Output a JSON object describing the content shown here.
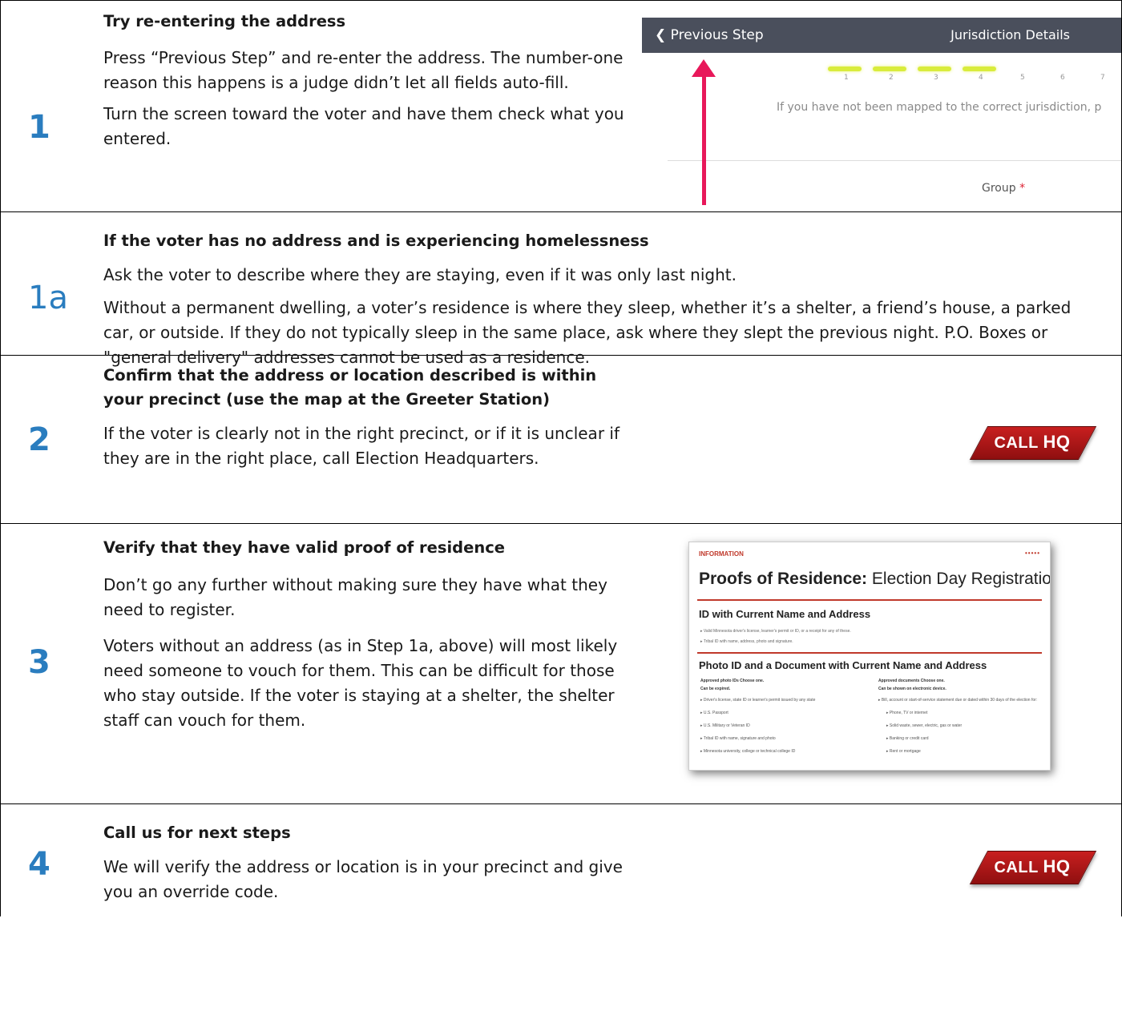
{
  "rows": [
    {
      "number": "1",
      "heading": "Try re-entering the address",
      "paragraphs": [
        "Press “Previous Step” and re-enter the address. The number-one reason this happens is a judge didn’t let all fields auto-fill.",
        "Turn the screen toward the voter and have them check what you entered."
      ],
      "screenshot": {
        "back_label": "Previous Step",
        "title": "Jurisdiction Details",
        "step_numbers": [
          "1",
          "2",
          "3",
          "4",
          "5",
          "6",
          "7"
        ],
        "note": "If you have not been mapped to the correct jurisdiction, p",
        "field_label": "Group",
        "required_mark": "*"
      }
    },
    {
      "number": "1a",
      "heading": "If the voter has no address and is experiencing homelessness",
      "paragraphs": [
        "Ask the voter to describe where they are staying, even if it was only last night.",
        "Without a permanent dwelling, a voter’s residence is where they sleep, whether it’s a shelter, a friend’s house, a parked car, or outside. If they do not typically sleep in the same place, ask where they slept the previous night. P.O. Boxes or \"general delivery\" addresses cannot be used as a residence."
      ]
    },
    {
      "number": "2",
      "heading": "Confirm that the address or location described is within your precinct (use the map at the Greeter Station)",
      "paragraphs": [
        "If the voter is clearly not in the right precinct, or if it is unclear if they are in the right place, call Election Headquarters."
      ],
      "badge": {
        "call": "CALL",
        "hq": "HQ"
      }
    },
    {
      "number": "3",
      "heading": "Verify that they have valid proof of residence",
      "paragraphs": [
        "Don’t go any further without making sure they have what they need to register.",
        "Voters without an address (as in Step 1a, above) will most likely need someone to vouch for them. This can be difficult for those who stay outside. If the voter is staying at a shelter, the shelter staff can vouch for them."
      ],
      "handout": {
        "label": "INFORMATION",
        "title_bold": "Proofs of Residence:",
        "title_rest": "Election Day Registration",
        "section1": "ID with Current Name and Address",
        "section1_items": [
          "Valid Minnesota driver's license, learner's permit or ID, or a receipt for any of these.",
          "Tribal ID with name, address, photo and signature."
        ],
        "section2": "Photo ID and a Document with Current Name and Address",
        "left_head": [
          "Approved photo IDs Choose one.",
          "Can be expired."
        ],
        "left_items": [
          "Driver's license, state ID or learner's permit issued by any state",
          "U.S. Passport",
          "U.S. Military or Veteran ID",
          "Tribal ID with name, signature and photo",
          "Minnesota university, college or technical college ID"
        ],
        "right_head": [
          "Approved documents Choose one.",
          "Can be shown on electronic device."
        ],
        "right_items": [
          "Bill, account or start-of-service statement due or dated within 30 days of the election for:",
          "Phone, TV or internet",
          "Solid waste, sewer, electric, gas or water",
          "Banking or credit card",
          "Rent or mortgage"
        ]
      }
    },
    {
      "number": "4",
      "heading": "Call us for next steps",
      "paragraphs": [
        "We will verify the address or location is in your precinct and give you an override code."
      ],
      "badge": {
        "call": "CALL",
        "hq": "HQ"
      }
    }
  ],
  "colors": {
    "step_number": "#2a7dbf",
    "arrow": "#e8185a",
    "badge": "#b81818",
    "highlight": "#d9ec3c"
  }
}
